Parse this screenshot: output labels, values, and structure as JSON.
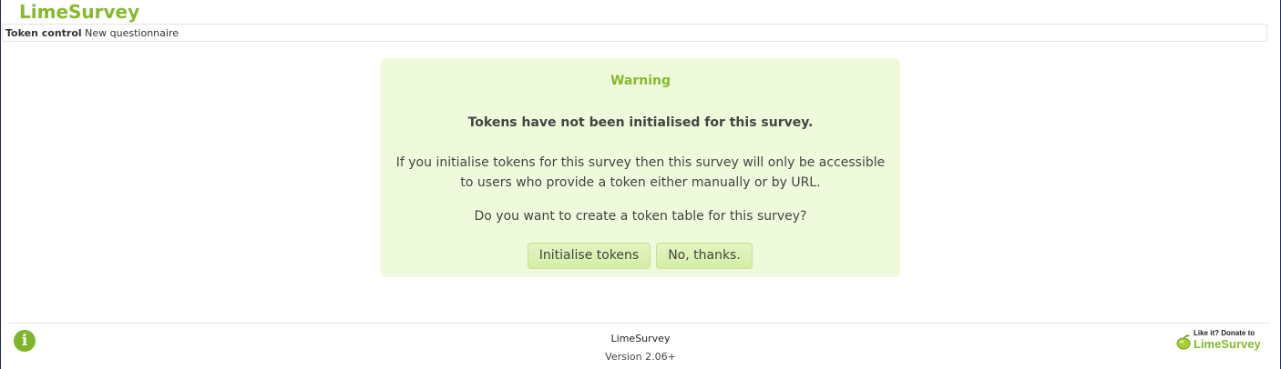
{
  "app": {
    "logo_text": "LimeSurvey",
    "brand_color": "#84ba2b"
  },
  "menubar": {
    "section": "Token control",
    "survey_name": "New questionnaire"
  },
  "warning": {
    "title": "Warning",
    "heading": "Tokens have not been initialised for this survey.",
    "message": "If you initialise tokens for this survey then this survey will only be accessible to users who provide a token either manually or by URL.",
    "question": "Do you want to create a token table for this survey?",
    "buttons": {
      "initialise": "Initialise tokens",
      "decline": "No, thanks."
    },
    "background_color": "#effadc"
  },
  "footer": {
    "info_icon": "info-icon",
    "name": "LimeSurvey",
    "version": "Version 2.06+",
    "donate_line1": "Like it? Donate to",
    "donate_brand": "LimeSurvey"
  }
}
